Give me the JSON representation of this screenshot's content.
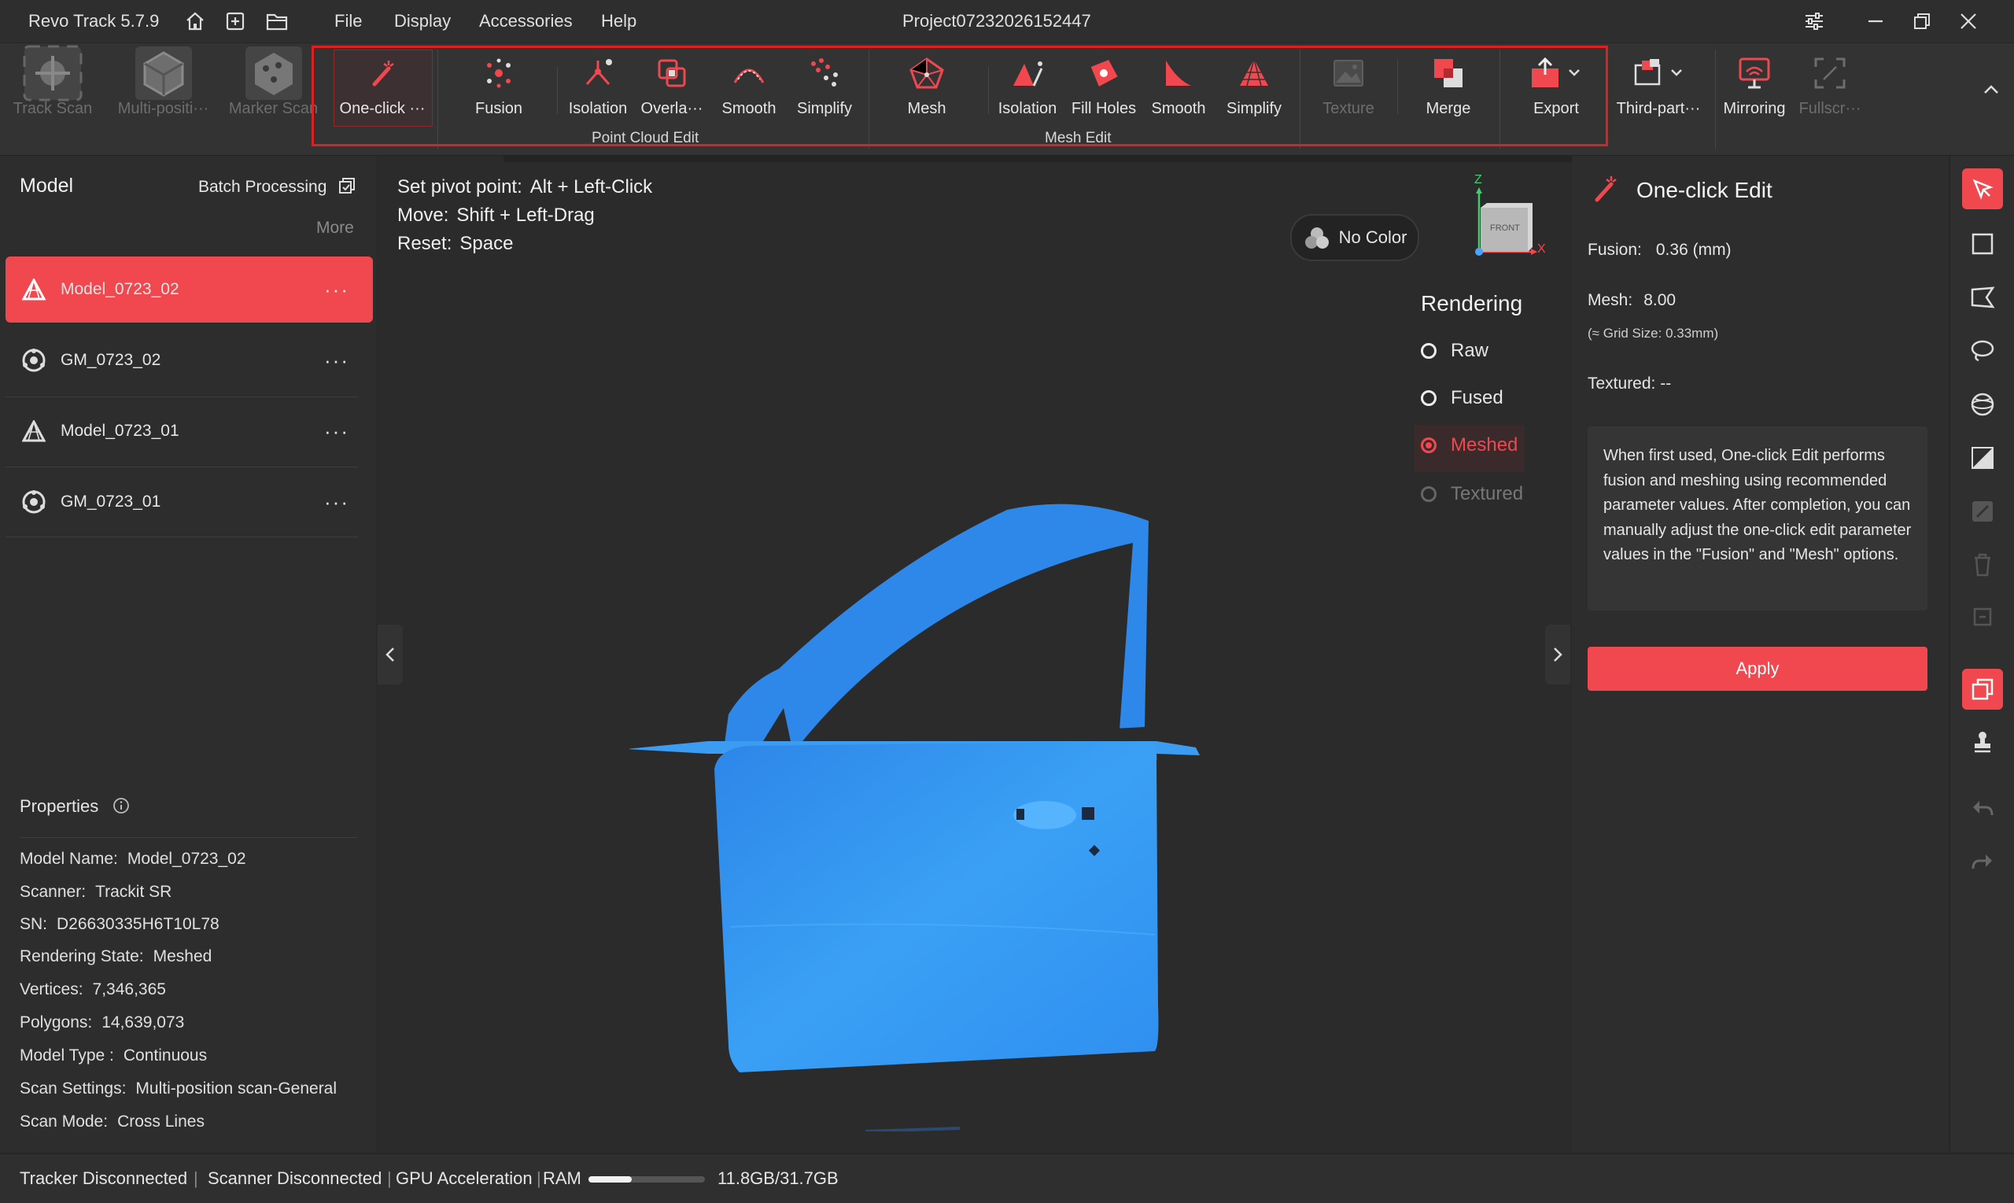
{
  "app": {
    "title": "Revo Track 5.7.9",
    "project": "Project07232026152447"
  },
  "menu": [
    "File",
    "Display",
    "Accessories",
    "Help"
  ],
  "ribbon": {
    "scan": [
      {
        "label": "Track Scan",
        "icon": "track-scan-icon"
      },
      {
        "label": "Multi-positi···",
        "icon": "multi-position-icon"
      },
      {
        "label": "Marker Scan",
        "icon": "marker-scan-icon"
      }
    ],
    "one_click": "One-click ···",
    "point_cloud": [
      {
        "label": "Fusion",
        "icon": "fusion-icon"
      },
      {
        "label": "Isolation",
        "icon": "isolation-icon"
      },
      {
        "label": "Overla···",
        "icon": "overlap-icon"
      },
      {
        "label": "Smooth",
        "icon": "smooth-icon"
      },
      {
        "label": "Simplify",
        "icon": "simplify-icon"
      }
    ],
    "point_cloud_group": "Point Cloud Edit",
    "mesh": {
      "label": "Mesh",
      "icon": "mesh-icon"
    },
    "mesh_edit": [
      {
        "label": "Isolation",
        "icon": "mesh-isolation-icon"
      },
      {
        "label": "Fill Holes",
        "icon": "fill-holes-icon"
      },
      {
        "label": "Smooth",
        "icon": "mesh-smooth-icon"
      },
      {
        "label": "Simplify",
        "icon": "mesh-simplify-icon"
      }
    ],
    "mesh_edit_group": "Mesh Edit",
    "texture": "Texture",
    "merge": "Merge",
    "export": "Export",
    "third_party": "Third-part···",
    "mirroring": "Mirroring",
    "fullscreen": "Fullscr···"
  },
  "left": {
    "title": "Model",
    "batch": "Batch Processing",
    "more": "More",
    "models": [
      {
        "name": "Model_0723_02",
        "type": "mesh",
        "selected": true
      },
      {
        "name": "GM_0723_02",
        "type": "global-marker",
        "selected": false
      },
      {
        "name": "Model_0723_01",
        "type": "mesh",
        "selected": false
      },
      {
        "name": "GM_0723_01",
        "type": "global-marker",
        "selected": false
      }
    ],
    "properties_title": "Properties",
    "properties": [
      {
        "k": "Model Name:",
        "v": "Model_0723_02"
      },
      {
        "k": "Scanner:",
        "v": "Trackit SR"
      },
      {
        "k": "SN:",
        "v": "D26630335H6T10L78"
      },
      {
        "k": "Rendering State:",
        "v": "Meshed"
      },
      {
        "k": "Vertices:",
        "v": "7,346,365"
      },
      {
        "k": "Polygons:",
        "v": "14,639,073"
      },
      {
        "k": "Model Type :",
        "v": "Continuous"
      },
      {
        "k": "Scan Settings:",
        "v": "Multi-position scan-General"
      },
      {
        "k": "Scan Mode:",
        "v": "Cross Lines"
      }
    ]
  },
  "viewport": {
    "hints": [
      {
        "k": "Set pivot point:",
        "v": "Alt + Left-Click"
      },
      {
        "k": "Move:",
        "v": "Shift + Left-Drag"
      },
      {
        "k": "Reset:",
        "v": "Space"
      }
    ],
    "color_btn": "No Color",
    "axis": {
      "z": "Z",
      "x": "X",
      "face": "FRONT"
    },
    "rendering_title": "Rendering",
    "rendering": [
      {
        "label": "Raw",
        "state": "enabled"
      },
      {
        "label": "Fused",
        "state": "enabled"
      },
      {
        "label": "Meshed",
        "state": "selected"
      },
      {
        "label": "Textured",
        "state": "disabled"
      }
    ],
    "model_color": "#2f8ff0"
  },
  "right": {
    "title": "One-click Edit",
    "fusion_k": "Fusion:",
    "fusion_v": "0.36 (mm)",
    "mesh_k": "Mesh:",
    "mesh_v": "8.00",
    "grid": "(≈ Grid Size: 0.33mm)",
    "textured": "Textured: --",
    "info": "When first used, One-click Edit performs fusion and meshing using recommended parameter values. After completion, you can manually adjust the one-click edit parameter values in the \"Fusion\" and \"Mesh\" options.",
    "apply": "Apply"
  },
  "status": {
    "tracker": "Tracker Disconnected",
    "scanner": "Scanner Disconnected",
    "gpu": "GPU Acceleration",
    "ram_label": "RAM",
    "ram": "11.8GB/31.7GB",
    "ram_fraction": 0.37
  },
  "colors": {
    "accent": "#f0484e",
    "model": "#2f8ff0"
  }
}
